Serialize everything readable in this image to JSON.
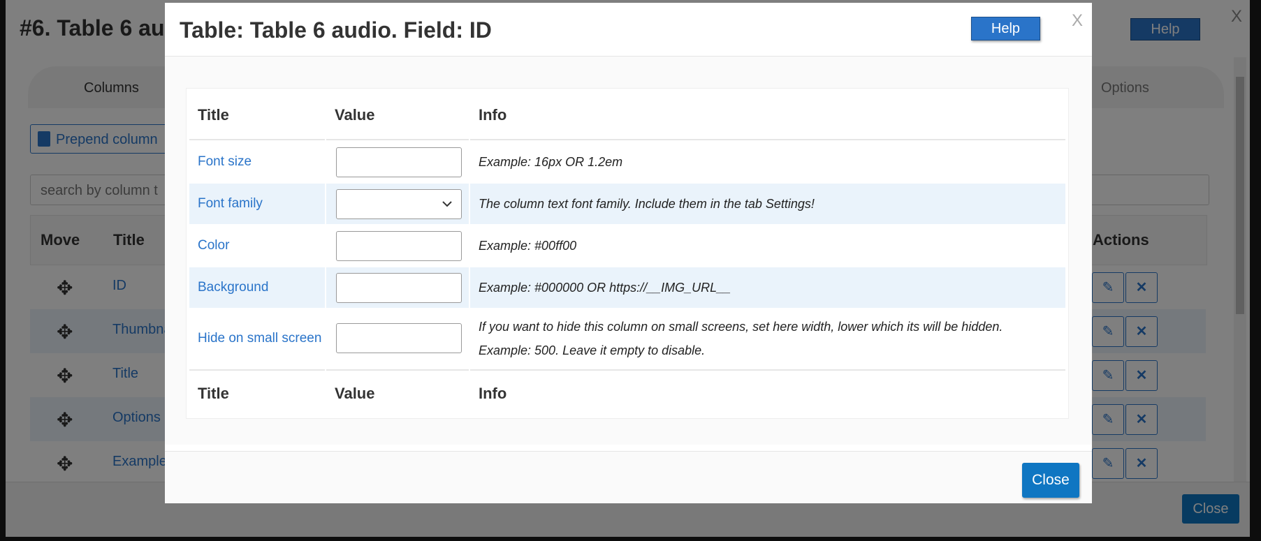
{
  "background": {
    "page_title": "#6. Table 6 au",
    "help_label": "Help",
    "close_x": "X",
    "tabs": {
      "columns": "Columns",
      "options": "Options"
    },
    "prepend_label": "Prepend column",
    "search_placeholder": "search by column t",
    "table_headers": {
      "move": "Move",
      "title": "Title",
      "actions": "Actions"
    },
    "rows": [
      {
        "title": "ID"
      },
      {
        "title": "Thumbna"
      },
      {
        "title": "Title"
      },
      {
        "title": "Options"
      },
      {
        "title": "Example"
      }
    ],
    "close_label": "Close"
  },
  "modal": {
    "title": "Table: Table 6 audio. Field: ID",
    "help_label": "Help",
    "close_x": "X",
    "headers": {
      "title": "Title",
      "value": "Value",
      "info": "Info"
    },
    "rows": [
      {
        "title": "Font size",
        "value": "",
        "info": "Example: 16px OR 1.2em"
      },
      {
        "title": "Font family",
        "value": "",
        "info": "The column text font family. Include them in the tab Settings!"
      },
      {
        "title": "Color",
        "value": "",
        "info": "Example: #00ff00"
      },
      {
        "title": "Background",
        "value": "",
        "info": "Example: #000000 OR https://__IMG_URL__"
      },
      {
        "title": "Hide on small screen",
        "value": "",
        "info": "If you want to hide this column on small screens, set here width, lower which its will be hidden. Example: 500. Leave it empty to disable."
      }
    ],
    "close_label": "Close"
  }
}
